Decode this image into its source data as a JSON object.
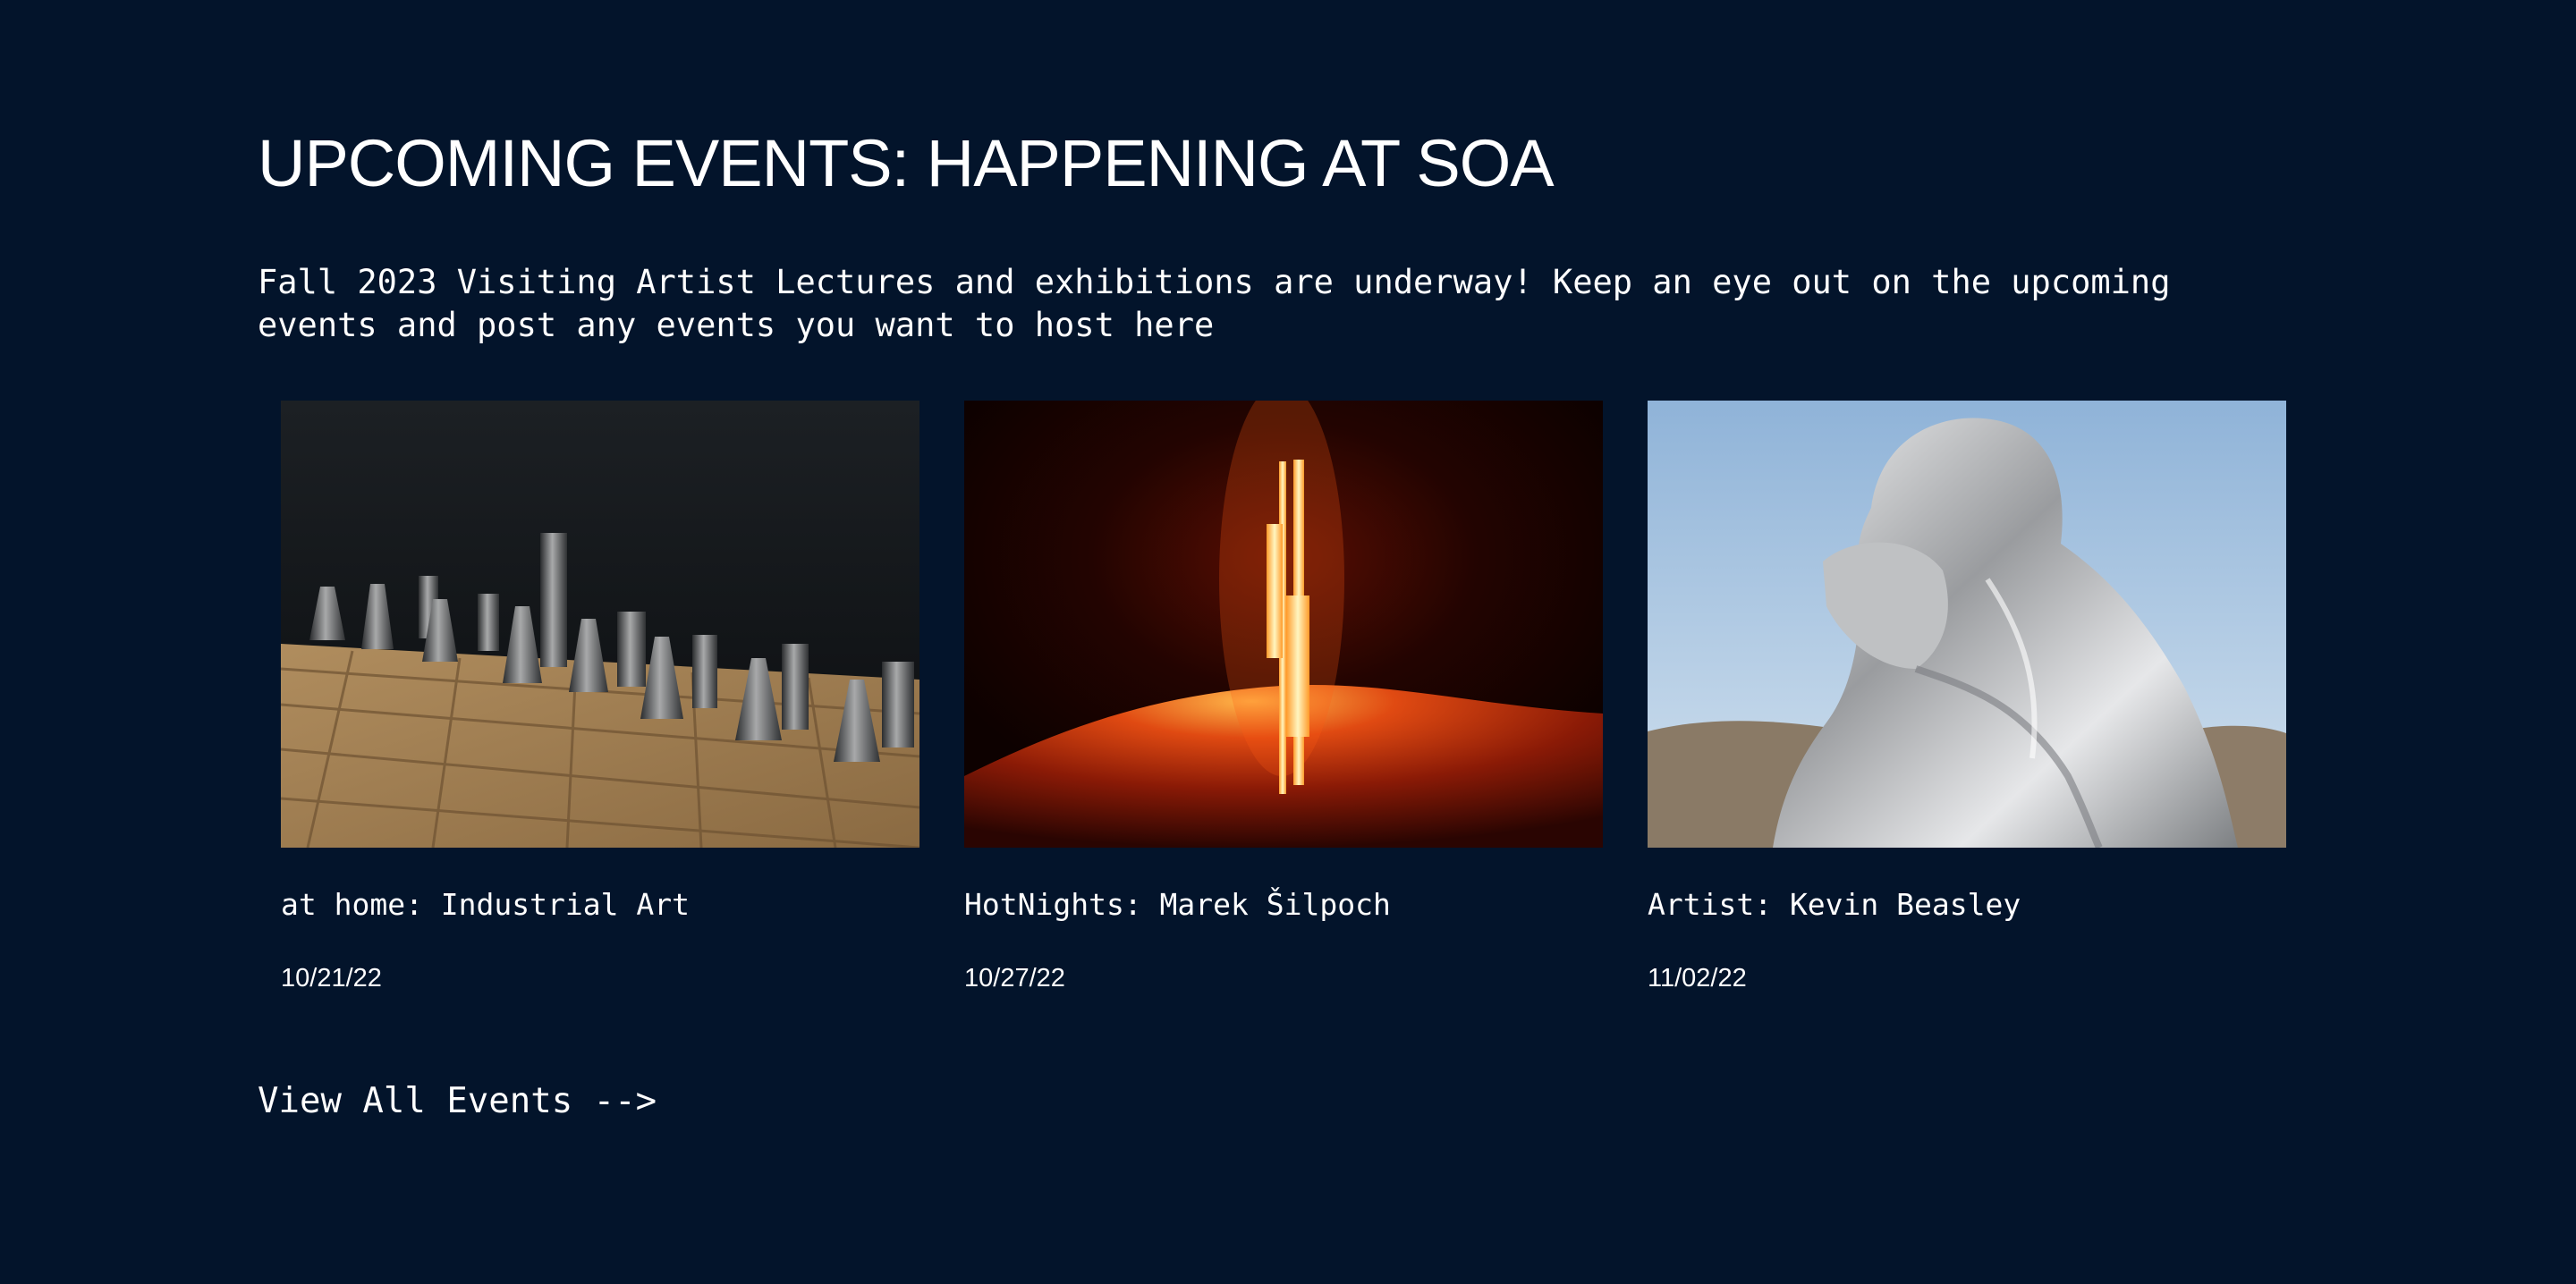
{
  "section": {
    "title": "UPCOMING EVENTS: HAPPENING AT SOA",
    "intro": "Fall 2023 Visiting Artist Lectures and exhibitions are underway! Keep an eye out on the upcoming events and post any events you want to host here"
  },
  "events": [
    {
      "title": "at home: Industrial Art",
      "date": "10/21/22",
      "image_icon": "chess-set-photo"
    },
    {
      "title": "HotNights: Marek Šilpoch",
      "date": "10/27/22",
      "image_icon": "neon-light-sculpture-photo"
    },
    {
      "title": "Artist: Kevin Beasley",
      "date": "11/02/22",
      "image_icon": "silver-draped-figure-photo"
    }
  ],
  "view_all": {
    "label": "View All Events -->"
  },
  "colors": {
    "background": "#03142b",
    "text": "#ffffff"
  }
}
